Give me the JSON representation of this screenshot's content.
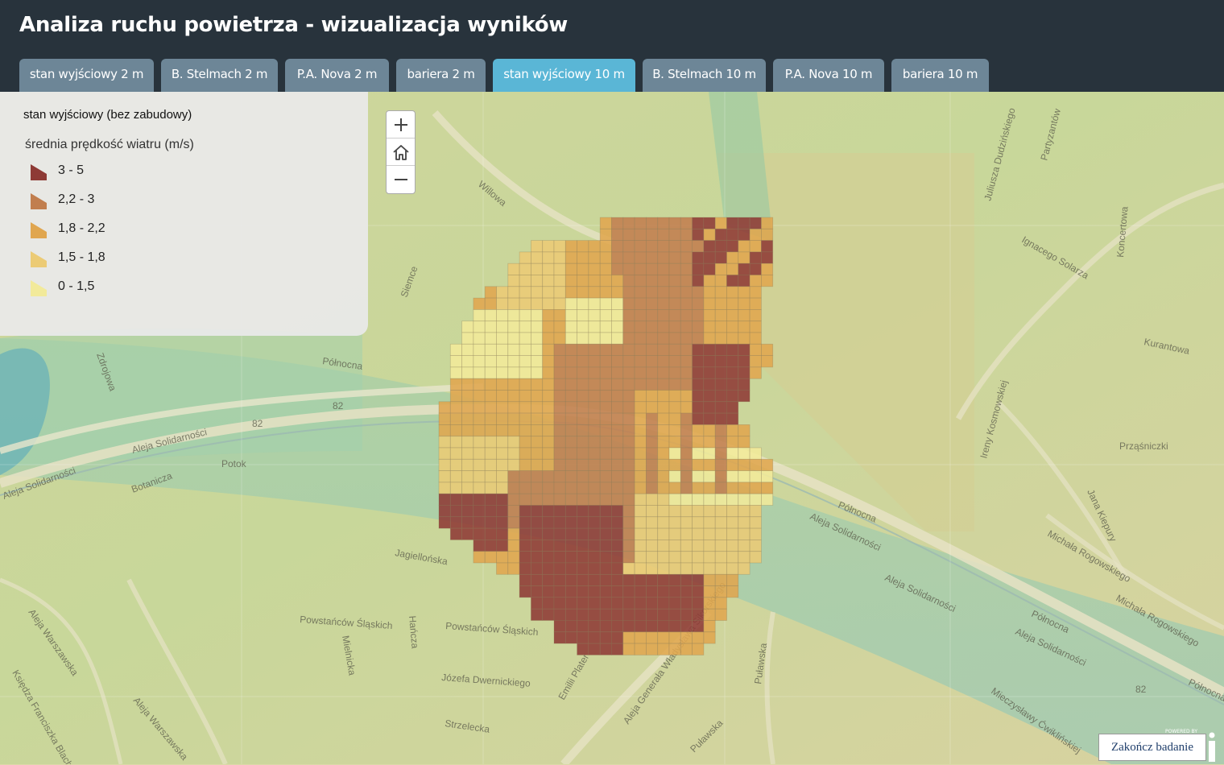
{
  "header": {
    "title": "Analiza ruchu powietrza - wizualizacja wyników"
  },
  "tabs": [
    {
      "label": "stan wyjściowy 2 m",
      "active": false
    },
    {
      "label": "B. Stelmach 2 m",
      "active": false
    },
    {
      "label": "P.A. Nova 2 m",
      "active": false
    },
    {
      "label": "bariera 2 m",
      "active": false
    },
    {
      "label": "stan wyjściowy 10 m",
      "active": true
    },
    {
      "label": "B. Stelmach 10 m",
      "active": false
    },
    {
      "label": "P.A. Nova 10 m",
      "active": false
    },
    {
      "label": "bariera 10 m",
      "active": false
    }
  ],
  "legend": {
    "title": "stan wyjściowy (bez zabudowy)",
    "subtitle": "średnia prędkość wiatru (m/s)",
    "classes": [
      {
        "label": "3 - 5",
        "color": "#8e3a35"
      },
      {
        "label": "2,2 - 3",
        "color": "#c17e4e"
      },
      {
        "label": "1,8 - 2,2",
        "color": "#e0a64f"
      },
      {
        "label": "1,5 - 1,8",
        "color": "#eccb75"
      },
      {
        "label": "0 - 1,5",
        "color": "#f2ea9a"
      }
    ]
  },
  "zoom_controls": {
    "zoom_in_icon": "plus-icon",
    "home_icon": "home-icon",
    "zoom_out_icon": "minus-icon"
  },
  "map_labels": [
    "Willowa",
    "Siemce",
    "Północna",
    "Zdrojowa",
    "Aleja Solidarności",
    "82",
    "Potok",
    "Botanicza",
    "Jagiellońska",
    "Powstańców Śląskich",
    "Józefa Dwernickiego",
    "Strzelecka",
    "Aleja Warszawska",
    "Księdza Franciszka Blachnickiego",
    "Mielnicka",
    "Hańcza",
    "Emilii Plater",
    "Aleja Generała Władysława Sikorskiego",
    "Puławska",
    "Mieczysławy Ćwiklińskiej",
    "Kurantowa",
    "Prząśniczki",
    "Koncertowa",
    "Ignacego Solarza",
    "Michała Rogowskiego",
    "Jana Kiepury",
    "Ireny Kosmowskiej",
    "Kołłątaja",
    "Partyzantów",
    "Juliusza Dudzińskiego"
  ],
  "footer": {
    "finish_button": "Zakończ badanie",
    "powered_by": "POWERED BY"
  }
}
